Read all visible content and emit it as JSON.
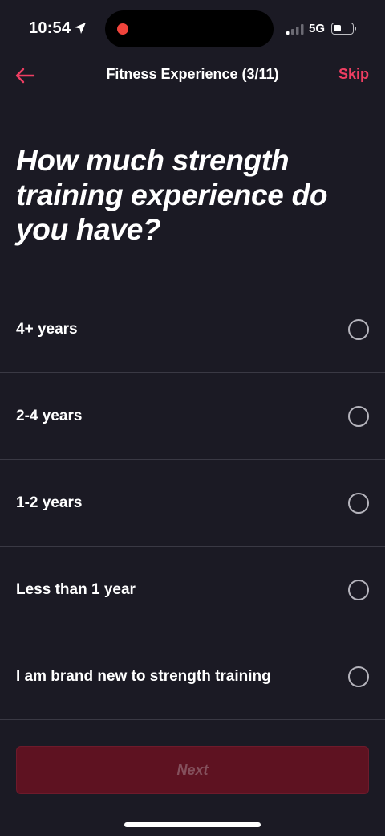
{
  "status_bar": {
    "time": "10:54",
    "network": "5G",
    "location_icon": "location-arrow-icon",
    "signal_icon": "signal-bars-icon",
    "battery_icon": "battery-icon",
    "battery_level": 0.35
  },
  "header": {
    "back_icon": "arrow-left-icon",
    "title": "Fitness Experience (3/11)",
    "skip_label": "Skip"
  },
  "question": "How much strength training experience do you have?",
  "options": [
    {
      "label": "4+ years",
      "selected": false
    },
    {
      "label": "2-4 years",
      "selected": false
    },
    {
      "label": "1-2 years",
      "selected": false
    },
    {
      "label": "Less than 1 year",
      "selected": false
    },
    {
      "label": "I am brand new to strength training",
      "selected": false
    }
  ],
  "next_label": "Next",
  "colors": {
    "background": "#1b1a24",
    "accent": "#ee3e62",
    "next_button_disabled": "#5e1221",
    "divider": "#3a3944"
  }
}
